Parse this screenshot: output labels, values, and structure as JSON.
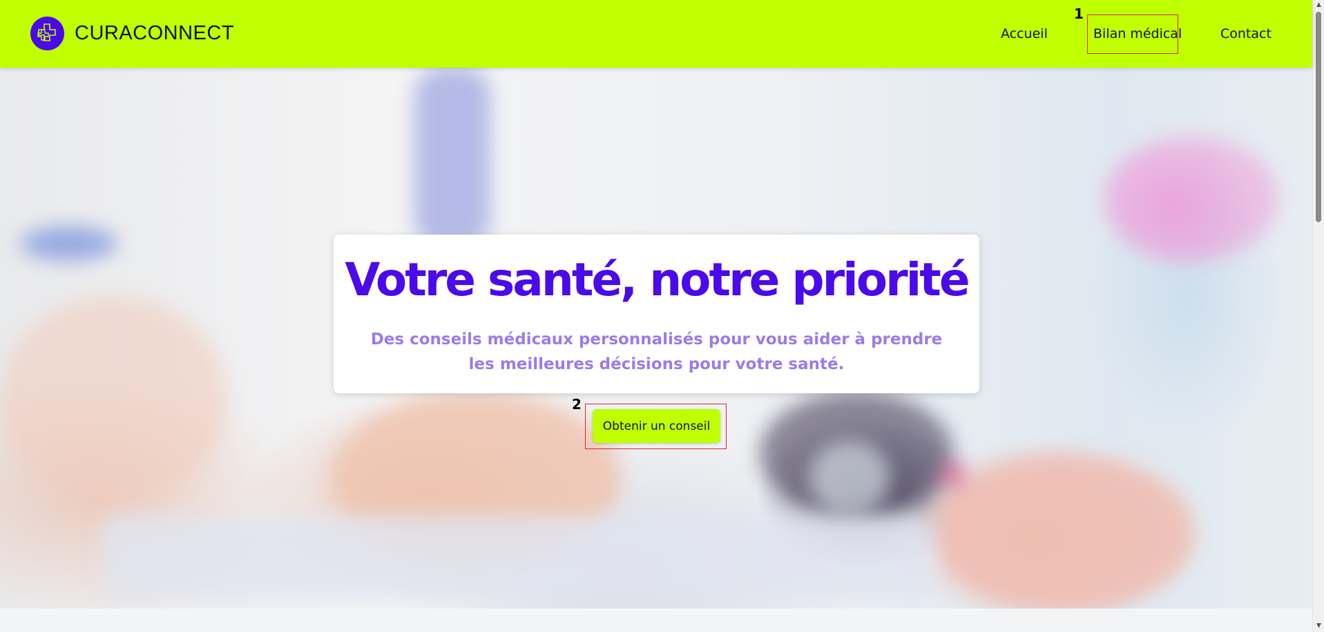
{
  "header": {
    "brand": "CURACONNECT",
    "nav": [
      {
        "label": "Accueil"
      },
      {
        "label": "Bilan médical"
      },
      {
        "label": "Contact"
      }
    ]
  },
  "hero": {
    "title": "Votre santé, notre priorité",
    "subtitle": "Des conseils médicaux personnalisés pour vous aider à prendre les meilleures décisions pour votre santé.",
    "cta_label": "Obtenir un conseil"
  },
  "annotations": [
    {
      "number": "1",
      "target": "Bilan médical"
    },
    {
      "number": "2",
      "target": "Obtenir un conseil"
    }
  ],
  "colors": {
    "accent_lime": "#bfff00",
    "brand_purple": "#4a0aea",
    "subtitle_lavender": "#9b7bea",
    "annotation_red": "#e0242b"
  },
  "icons": {
    "logo": "medical-cross-logo-icon"
  }
}
